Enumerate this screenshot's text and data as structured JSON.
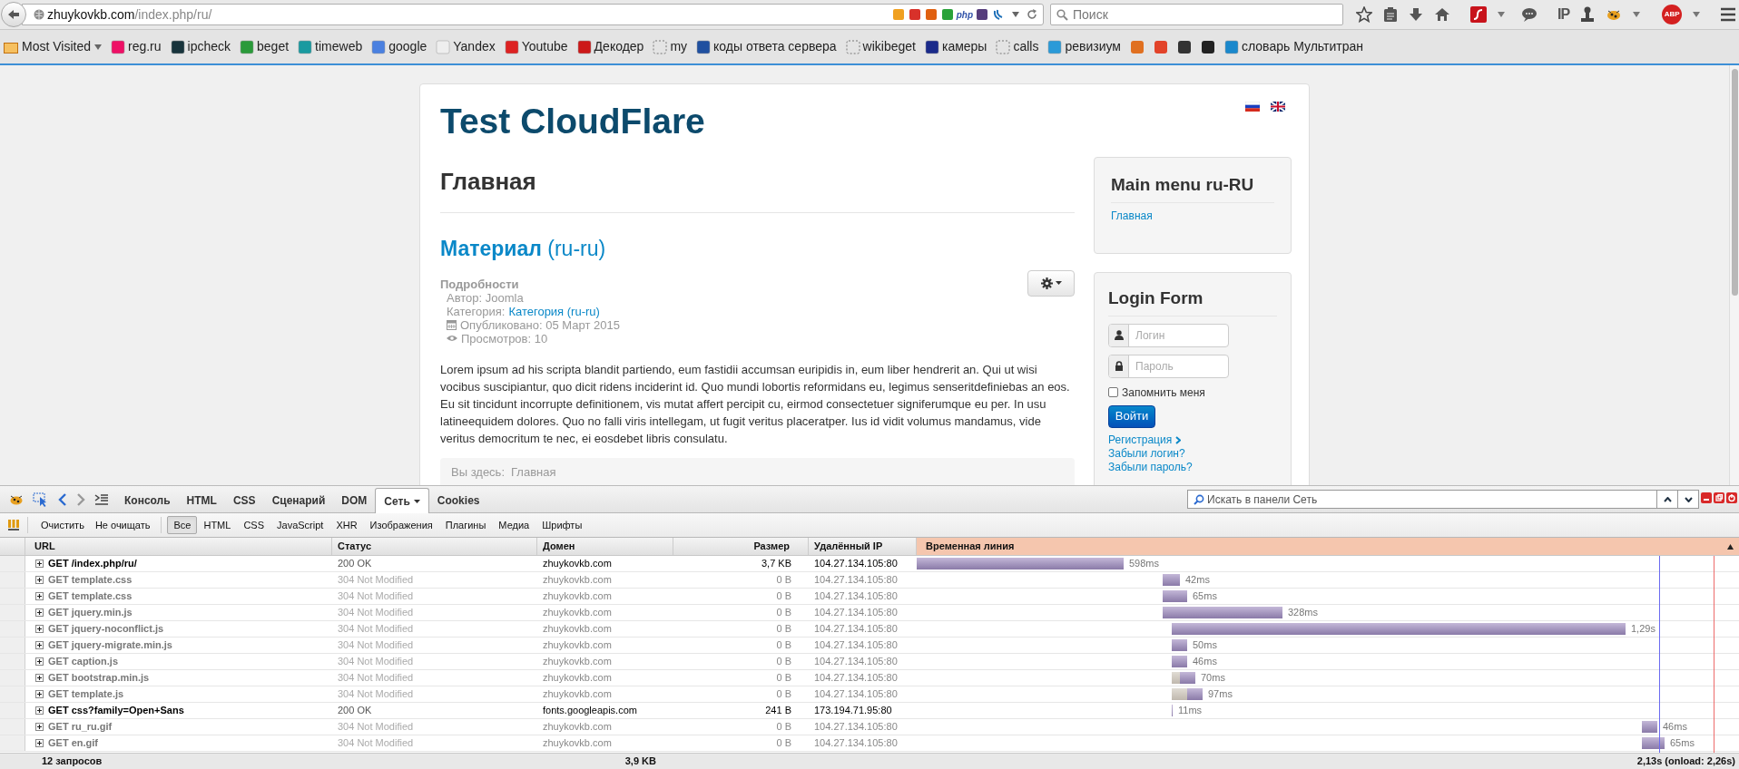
{
  "browser": {
    "url_host": "zhuykovkb.com",
    "url_path": "/index.php/ru/",
    "url_bar_badge": "php",
    "search_placeholder": "Поиск",
    "toolbar_ip_label": "IP",
    "adblock_label": "ABP"
  },
  "bookmarks": [
    {
      "kind": "folder",
      "label": "Most Visited"
    },
    {
      "kind": "link",
      "label": "reg.ru"
    },
    {
      "kind": "link",
      "label": "ipcheck"
    },
    {
      "kind": "link",
      "label": "beget"
    },
    {
      "kind": "link",
      "label": "timeweb"
    },
    {
      "kind": "link",
      "label": "google"
    },
    {
      "kind": "link",
      "label": "Yandex"
    },
    {
      "kind": "link",
      "label": "Youtube"
    },
    {
      "kind": "link",
      "label": "Декодер"
    },
    {
      "kind": "link",
      "label": "my"
    },
    {
      "kind": "link",
      "label": "коды ответа сервера"
    },
    {
      "kind": "link",
      "label": "wikibeget"
    },
    {
      "kind": "link",
      "label": "камеры"
    },
    {
      "kind": "link",
      "label": "calls"
    },
    {
      "kind": "link",
      "label": "ревизиум"
    },
    {
      "kind": "icon"
    },
    {
      "kind": "icon"
    },
    {
      "kind": "icon"
    },
    {
      "kind": "icon"
    },
    {
      "kind": "link",
      "label": "словарь Мультитран"
    }
  ],
  "page": {
    "site_title": "Test CloudFlare",
    "page_heading": "Главная",
    "article": {
      "title": "**Материал** (ru-ru)",
      "details_heading": "Подробности",
      "author": "Автор: Joomla",
      "category_label": "Категория:",
      "category_link": "Категория (ru-ru)",
      "published": "Опубликовано: 05 Март 2015",
      "hits": "Просмотров: 10",
      "body": "Lorem ipsum ad his scripta blandit partiendo, eum fastidii accumsan euripidis in, eum liber hendrerit an. Qui ut wisi vocibus suscipiantur, quo dicit ridens inciderint id. Quo mundi lobortis reformidans eu, legimus senseritdefiniebas an eos. Eu sit tincidunt incorrupte definitionem, vis mutat affert percipit cu, eirmod consectetuer signiferumque eu per. In usu latineequidem dolores. Quo no falli viris intellegam, ut fugit veritus placeratper. Ius id vidit volumus mandamus, vide veritus democritum te nec, ei eosdebet libris consulatu."
    },
    "breadcrumb": {
      "label": "Вы здесь:",
      "current": "Главная"
    },
    "main_menu": {
      "title": "Main menu ru-RU",
      "items": [
        "Главная"
      ]
    },
    "login": {
      "title": "Login Form",
      "username_placeholder": "Логин",
      "password_placeholder": "Пароль",
      "remember": {
        "label": "Запомнить меня",
        "checked": false
      },
      "submit": "Войти",
      "links": [
        "Регистрация",
        "Забыли логин?",
        "Забыли пароль?"
      ]
    }
  },
  "devtools": {
    "tabs": [
      {
        "label": "Консоль",
        "selected": false
      },
      {
        "label": "HTML",
        "selected": false
      },
      {
        "label": "CSS",
        "selected": false
      },
      {
        "label": "Сценарий",
        "selected": false
      },
      {
        "label": "DOM",
        "selected": false
      },
      {
        "label": "Сеть",
        "selected": true
      },
      {
        "label": "Cookies",
        "selected": false
      }
    ],
    "search_placeholder": "Искать в панели Сеть",
    "actions": [
      "Очистить",
      "Не очищать"
    ],
    "filters": [
      {
        "label": "Все",
        "selected": true
      },
      {
        "label": "HTML",
        "selected": false
      },
      {
        "label": "CSS",
        "selected": false
      },
      {
        "label": "JavaScript",
        "selected": false
      },
      {
        "label": "XHR",
        "selected": false
      },
      {
        "label": "Изображения",
        "selected": false
      },
      {
        "label": "Плагины",
        "selected": false
      },
      {
        "label": "Медиа",
        "selected": false
      },
      {
        "label": "Шрифты",
        "selected": false
      }
    ],
    "columns": [
      "URL",
      "Статус",
      "Домен",
      "Размер",
      "Удалённый IP",
      "Временная линия"
    ],
    "rows": [
      {
        "url": "GET /index.php/ru/",
        "status": "200 OK",
        "domain": "zhuykovkb.com",
        "size": "3,7 KB",
        "ip": "104.27.134.105:80",
        "time": "598ms",
        "cached": false
      },
      {
        "url": "GET template.css",
        "status": "304 Not Modified",
        "domain": "zhuykovkb.com",
        "size": "0 B",
        "ip": "104.27.134.105:80",
        "time": "42ms",
        "cached": true
      },
      {
        "url": "GET template.css",
        "status": "304 Not Modified",
        "domain": "zhuykovkb.com",
        "size": "0 B",
        "ip": "104.27.134.105:80",
        "time": "65ms",
        "cached": true
      },
      {
        "url": "GET jquery.min.js",
        "status": "304 Not Modified",
        "domain": "zhuykovkb.com",
        "size": "0 B",
        "ip": "104.27.134.105:80",
        "time": "328ms",
        "cached": true
      },
      {
        "url": "GET jquery-noconflict.js",
        "status": "304 Not Modified",
        "domain": "zhuykovkb.com",
        "size": "0 B",
        "ip": "104.27.134.105:80",
        "time": "1,29s",
        "cached": true
      },
      {
        "url": "GET jquery-migrate.min.js",
        "status": "304 Not Modified",
        "domain": "zhuykovkb.com",
        "size": "0 B",
        "ip": "104.27.134.105:80",
        "time": "50ms",
        "cached": true
      },
      {
        "url": "GET caption.js",
        "status": "304 Not Modified",
        "domain": "zhuykovkb.com",
        "size": "0 B",
        "ip": "104.27.134.105:80",
        "time": "46ms",
        "cached": true
      },
      {
        "url": "GET bootstrap.min.js",
        "status": "304 Not Modified",
        "domain": "zhuykovkb.com",
        "size": "0 B",
        "ip": "104.27.134.105:80",
        "time": "70ms",
        "cached": true
      },
      {
        "url": "GET template.js",
        "status": "304 Not Modified",
        "domain": "zhuykovkb.com",
        "size": "0 B",
        "ip": "104.27.134.105:80",
        "time": "97ms",
        "cached": true
      },
      {
        "url": "GET css?family=Open+Sans",
        "status": "200 OK",
        "domain": "fonts.googleapis.com",
        "size": "241 B",
        "ip": "173.194.71.95:80",
        "time": "11ms",
        "cached": false
      },
      {
        "url": "GET ru_ru.gif",
        "status": "304 Not Modified",
        "domain": "zhuykovkb.com",
        "size": "0 B",
        "ip": "104.27.134.105:80",
        "time": "46ms",
        "cached": true
      },
      {
        "url": "GET en.gif",
        "status": "304 Not Modified",
        "domain": "zhuykovkb.com",
        "size": "0 B",
        "ip": "104.27.134.105:80",
        "time": "65ms",
        "cached": true
      }
    ],
    "footer": {
      "requests": "12 запросов",
      "total_size": "3,9 KB",
      "total_time": "2,13s (onload: 2,26s)"
    }
  }
}
